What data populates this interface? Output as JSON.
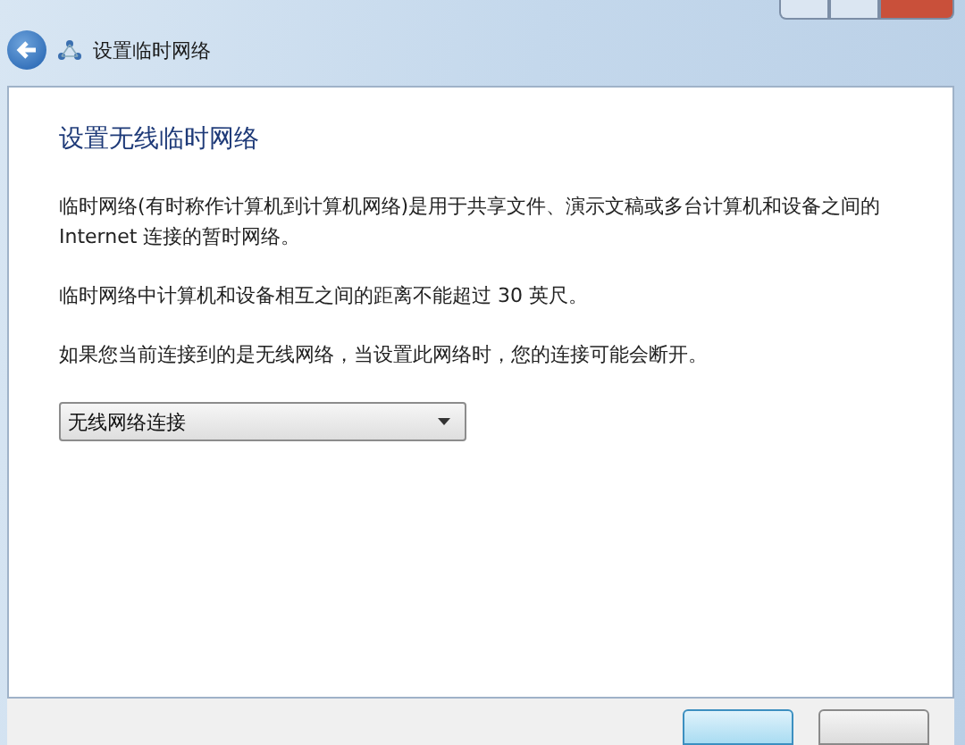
{
  "window": {
    "title": "设置临时网络"
  },
  "heading": "设置无线临时网络",
  "paragraphs": [
    "临时网络(有时称作计算机到计算机网络)是用于共享文件、演示文稿或多台计算机和设备之间的 Internet 连接的暂时网络。",
    "临时网络中计算机和设备相互之间的距离不能超过 30 英尺。",
    "如果您当前连接到的是无线网络，当设置此网络时，您的连接可能会断开。"
  ],
  "dropdown": {
    "value": "无线网络连接"
  },
  "footer_buttons": [
    {
      "kind": "primary"
    },
    {
      "kind": "secondary"
    }
  ]
}
